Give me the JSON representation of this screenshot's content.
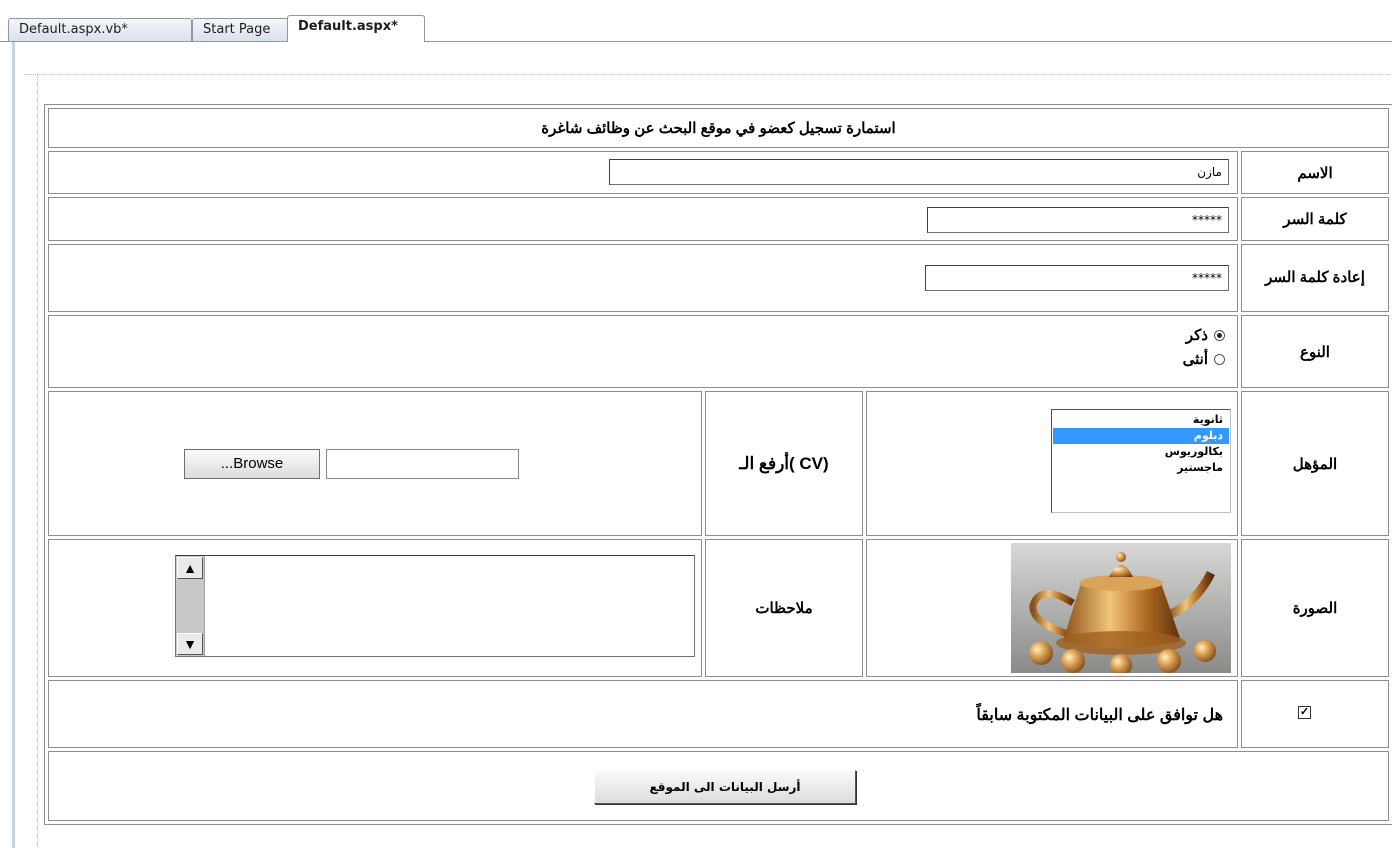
{
  "tabs": [
    {
      "label": "Default.aspx.vb*",
      "active": false
    },
    {
      "label": "Start Page",
      "active": false
    },
    {
      "label": "Default.aspx*",
      "active": true
    }
  ],
  "form": {
    "title": "استمارة تسجيل كعضو في موقع  البحث عن وظائف شاغرة",
    "name_label": "الاسم",
    "name_value": "مازن",
    "password_label": "كلمة السر",
    "password_value": "*****",
    "confirm_label": "إعادة كلمة السر",
    "confirm_value": "*****",
    "gender_label": "النوع",
    "gender_options": [
      {
        "label": "ذكر",
        "selected": true
      },
      {
        "label": "أنثى",
        "selected": false
      }
    ],
    "qualification_label": "المؤهل",
    "qualification_options": [
      {
        "label": "ثانوية",
        "selected": false
      },
      {
        "label": "دبلوم",
        "selected": true
      },
      {
        "label": "بكالوريوس",
        "selected": false
      },
      {
        "label": "ماجستير",
        "selected": false
      }
    ],
    "cv_label": "أرفع الـ( CV)",
    "browse_label": "...Browse",
    "photo_label": "الصورة",
    "notes_label": "ملاحظات",
    "agree_label": "هل توافق على البيانات المكتوبة سابقاً",
    "agree_checked": true,
    "submit_label": "أرسل البيانات الى الموقع"
  },
  "colors": {
    "selection": "#3399ff",
    "border": "#8d8d8d"
  },
  "icons": {
    "scroll_up": "scroll-up-arrow-icon",
    "scroll_down": "scroll-down-arrow-icon",
    "checkmark": "checkmark-icon"
  }
}
